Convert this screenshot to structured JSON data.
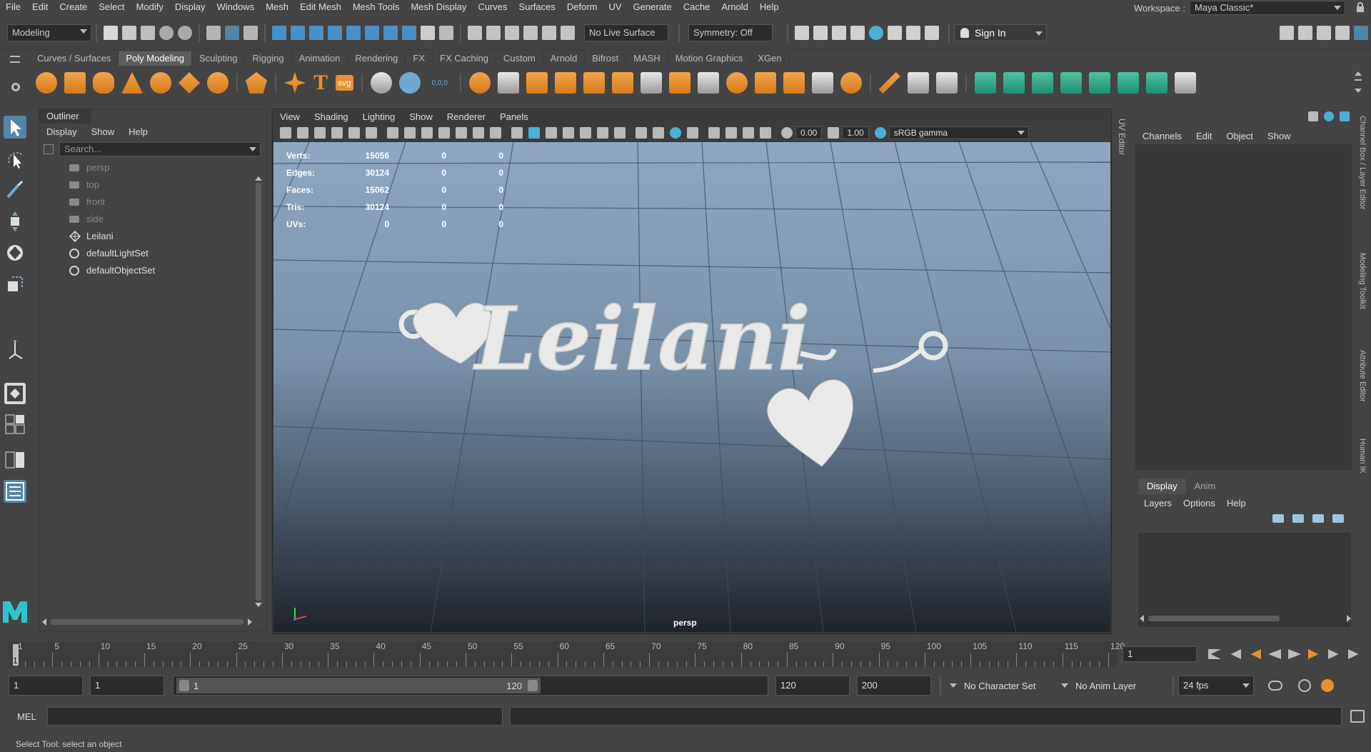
{
  "menubar": {
    "items": [
      "File",
      "Edit",
      "Create",
      "Select",
      "Modify",
      "Display",
      "Windows",
      "Mesh",
      "Edit Mesh",
      "Mesh Tools",
      "Mesh Display",
      "Curves",
      "Surfaces",
      "Deform",
      "UV",
      "Generate",
      "Cache",
      "Arnold",
      "Help"
    ],
    "workspace_label": "Workspace :",
    "workspace_value": "Maya Classic*"
  },
  "statusline": {
    "menuset": "Modeling",
    "live_surface": "No Live Surface",
    "symmetry": "Symmetry: Off",
    "sign_in": "Sign In"
  },
  "shelf": {
    "tabs": [
      "Curves / Surfaces",
      "Poly Modeling",
      "Sculpting",
      "Rigging",
      "Animation",
      "Rendering",
      "FX",
      "FX Caching",
      "Custom",
      "Arnold",
      "Bifrost",
      "MASH",
      "Motion Graphics",
      "XGen"
    ],
    "active_tab": "Poly Modeling",
    "text_tool": "T",
    "svg_tool": "svg",
    "point_icon_label": "0,0,0"
  },
  "outliner": {
    "title": "Outliner",
    "menu": [
      "Display",
      "Show",
      "Help"
    ],
    "search_placeholder": "Search...",
    "items": [
      {
        "name": "persp",
        "type": "camera",
        "dim": true
      },
      {
        "name": "top",
        "type": "camera",
        "dim": true
      },
      {
        "name": "front",
        "type": "camera",
        "dim": true
      },
      {
        "name": "side",
        "type": "camera",
        "dim": true
      },
      {
        "name": "Leilani",
        "type": "mesh",
        "dim": false
      },
      {
        "name": "defaultLightSet",
        "type": "set",
        "dim": false
      },
      {
        "name": "defaultObjectSet",
        "type": "set",
        "dim": false
      }
    ]
  },
  "viewport": {
    "menu": [
      "View",
      "Shading",
      "Lighting",
      "Show",
      "Renderer",
      "Panels"
    ],
    "exposure": "0.00",
    "gamma": "1.00",
    "color_space": "sRGB gamma",
    "camera": "persp",
    "hud": [
      {
        "label": "Verts:",
        "a": "15056",
        "b": "0",
        "c": "0"
      },
      {
        "label": "Edges:",
        "a": "30124",
        "b": "0",
        "c": "0"
      },
      {
        "label": "Faces:",
        "a": "15062",
        "b": "0",
        "c": "0"
      },
      {
        "label": "Tris:",
        "a": "30124",
        "b": "0",
        "c": "0"
      },
      {
        "label": "UVs:",
        "a": "0",
        "b": "0",
        "c": "0"
      }
    ],
    "model_text": "Leilani"
  },
  "side_labels": {
    "uv_editor": "UV Editor",
    "channel_box": "Channel Box / Layer Editor",
    "modeling_toolkit": "Modeling Toolkit",
    "attribute_editor": "Attribute Editor",
    "human_ik": "Human IK"
  },
  "channelbox": {
    "menu": [
      "Channels",
      "Edit",
      "Object",
      "Show"
    ],
    "layer_tabs": [
      "Display",
      "Anim"
    ],
    "active_layer_tab": "Display",
    "layer_menu": [
      "Layers",
      "Options",
      "Help"
    ]
  },
  "timeline": {
    "ticks": [
      "1",
      "5",
      "10",
      "15",
      "20",
      "25",
      "30",
      "35",
      "40",
      "45",
      "50",
      "55",
      "60",
      "65",
      "70",
      "75",
      "80",
      "85",
      "90",
      "95",
      "100",
      "105",
      "110",
      "115",
      "120"
    ],
    "current_frame": "1"
  },
  "range": {
    "start": "1",
    "anim_start": "1",
    "slider_start": "1",
    "slider_end": "120",
    "end": "120",
    "anim_end": "200",
    "character_set": "No Character Set",
    "anim_layer": "No Anim Layer",
    "fps": "24 fps"
  },
  "cmdline": {
    "lang": "MEL"
  },
  "helpline": {
    "text": "Select Tool: select an object"
  },
  "colors": {
    "ui_bg": "#444444",
    "field_bg": "#2b2b2b",
    "accent_orange": "#e8902e",
    "accent_green": "#2fa584",
    "active_tool": "#5285a6",
    "model_color": "#e9e9e9"
  }
}
